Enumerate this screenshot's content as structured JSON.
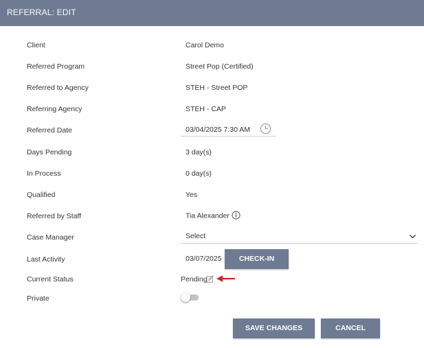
{
  "header": {
    "title": "REFERRAL: EDIT"
  },
  "fields": {
    "client": {
      "label": "Client",
      "value": "Carol Demo"
    },
    "referred_program": {
      "label": "Referred Program",
      "value": "Street Pop (Certified)"
    },
    "referred_to_agency": {
      "label": "Referred to Agency",
      "value": "STEH - Street POP"
    },
    "referring_agency": {
      "label": "Referring Agency",
      "value": "STEH - CAP"
    },
    "referred_date": {
      "label": "Referred Date",
      "value": "03/04/2025 7:30 AM"
    },
    "days_pending": {
      "label": "Days Pending",
      "value": "3 day(s)"
    },
    "in_process": {
      "label": "In Process",
      "value": "0 day(s)"
    },
    "qualified": {
      "label": "Qualified",
      "value": "Yes"
    },
    "referred_by_staff": {
      "label": "Referred by Staff",
      "value": "Tia Alexander"
    },
    "case_manager": {
      "label": "Case Manager",
      "value": "Select"
    },
    "last_activity": {
      "label": "Last Activity",
      "value": "03/07/2025",
      "button": "CHECK-IN"
    },
    "current_status": {
      "label": "Current Status",
      "value": "Pending"
    },
    "private": {
      "label": "Private",
      "enabled": false
    }
  },
  "actions": {
    "save": "SAVE CHANGES",
    "cancel": "CANCEL"
  },
  "icons": {
    "date": "clock-icon",
    "staff": "info-icon",
    "case_manager": "chevron-down-icon",
    "status": "edit-icon",
    "annotation": "red-arrow-icon"
  },
  "colors": {
    "header": "#6e7b93",
    "button": "#6e7b93",
    "annotation_arrow": "#d42020"
  }
}
